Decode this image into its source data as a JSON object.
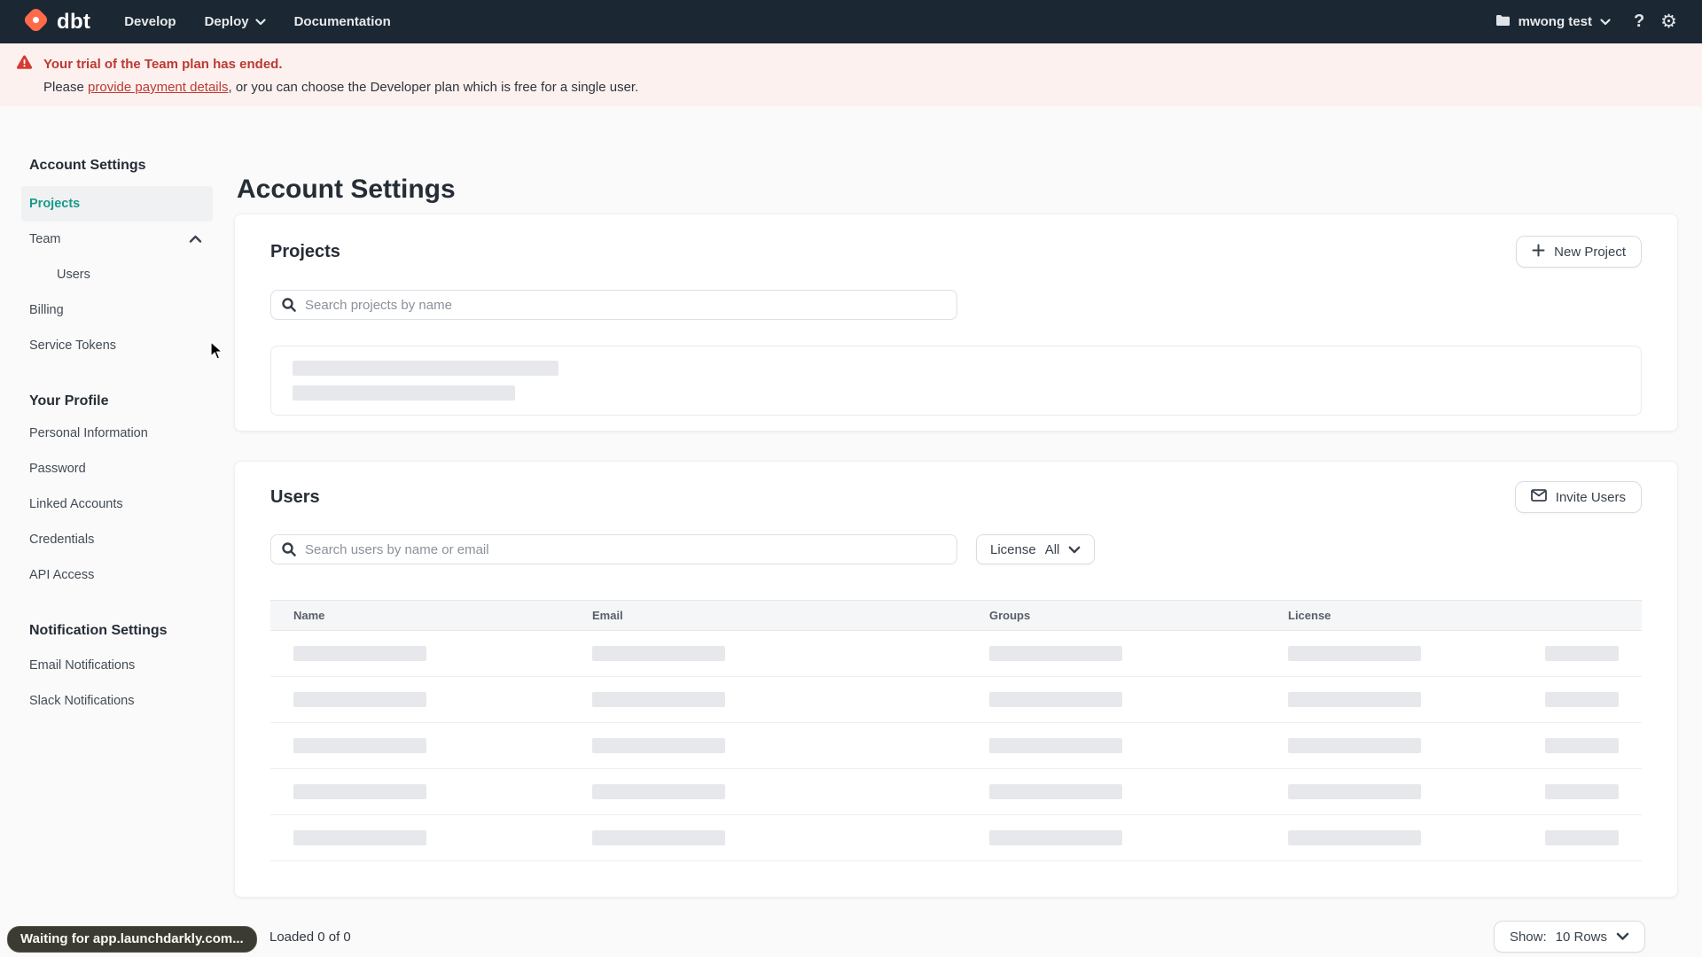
{
  "colors": {
    "nav_bg": "#1b2732",
    "brand_orange": "#ff6b4a",
    "accent_teal": "#189a8a",
    "banner_red": "#bc3a32",
    "banner_bg": "#fcf1ef"
  },
  "nav": {
    "logo_text": "dbt",
    "menu": [
      {
        "label": "Develop"
      },
      {
        "label": "Deploy"
      },
      {
        "label": "Documentation"
      }
    ],
    "account_label": "mwong test"
  },
  "banner": {
    "title": "Your trial of the Team plan has ended.",
    "body_prefix": "Please ",
    "link_text": "provide payment details",
    "body_suffix": ", or you can choose the Developer plan which is free for a single user."
  },
  "sidebar": {
    "sections": [
      {
        "heading": "Account Settings",
        "items": [
          {
            "label": "Projects"
          },
          {
            "label": "Team"
          },
          {
            "label": "Users"
          },
          {
            "label": "Billing"
          },
          {
            "label": "Service Tokens"
          }
        ]
      },
      {
        "heading": "Your Profile",
        "items": [
          {
            "label": "Personal Information"
          },
          {
            "label": "Password"
          },
          {
            "label": "Linked Accounts"
          },
          {
            "label": "Credentials"
          },
          {
            "label": "API Access"
          }
        ]
      },
      {
        "heading": "Notification Settings",
        "items": [
          {
            "label": "Email Notifications"
          },
          {
            "label": "Slack Notifications"
          }
        ]
      }
    ]
  },
  "main": {
    "title": "Account Settings",
    "projects_card": {
      "title": "Projects",
      "new_button": "New Project",
      "search_placeholder": "Search projects by name"
    },
    "users_card": {
      "title": "Users",
      "invite_button": "Invite Users",
      "search_placeholder": "Search users by name or email",
      "license_label": "License",
      "license_value": "All",
      "columns": [
        "Name",
        "Email",
        "Groups",
        "License"
      ],
      "footer_loaded": "Loaded 0 of 0",
      "show_label": "Show:",
      "show_value": "10 Rows"
    }
  },
  "status": {
    "text": "Waiting for app.launchdarkly.com..."
  }
}
